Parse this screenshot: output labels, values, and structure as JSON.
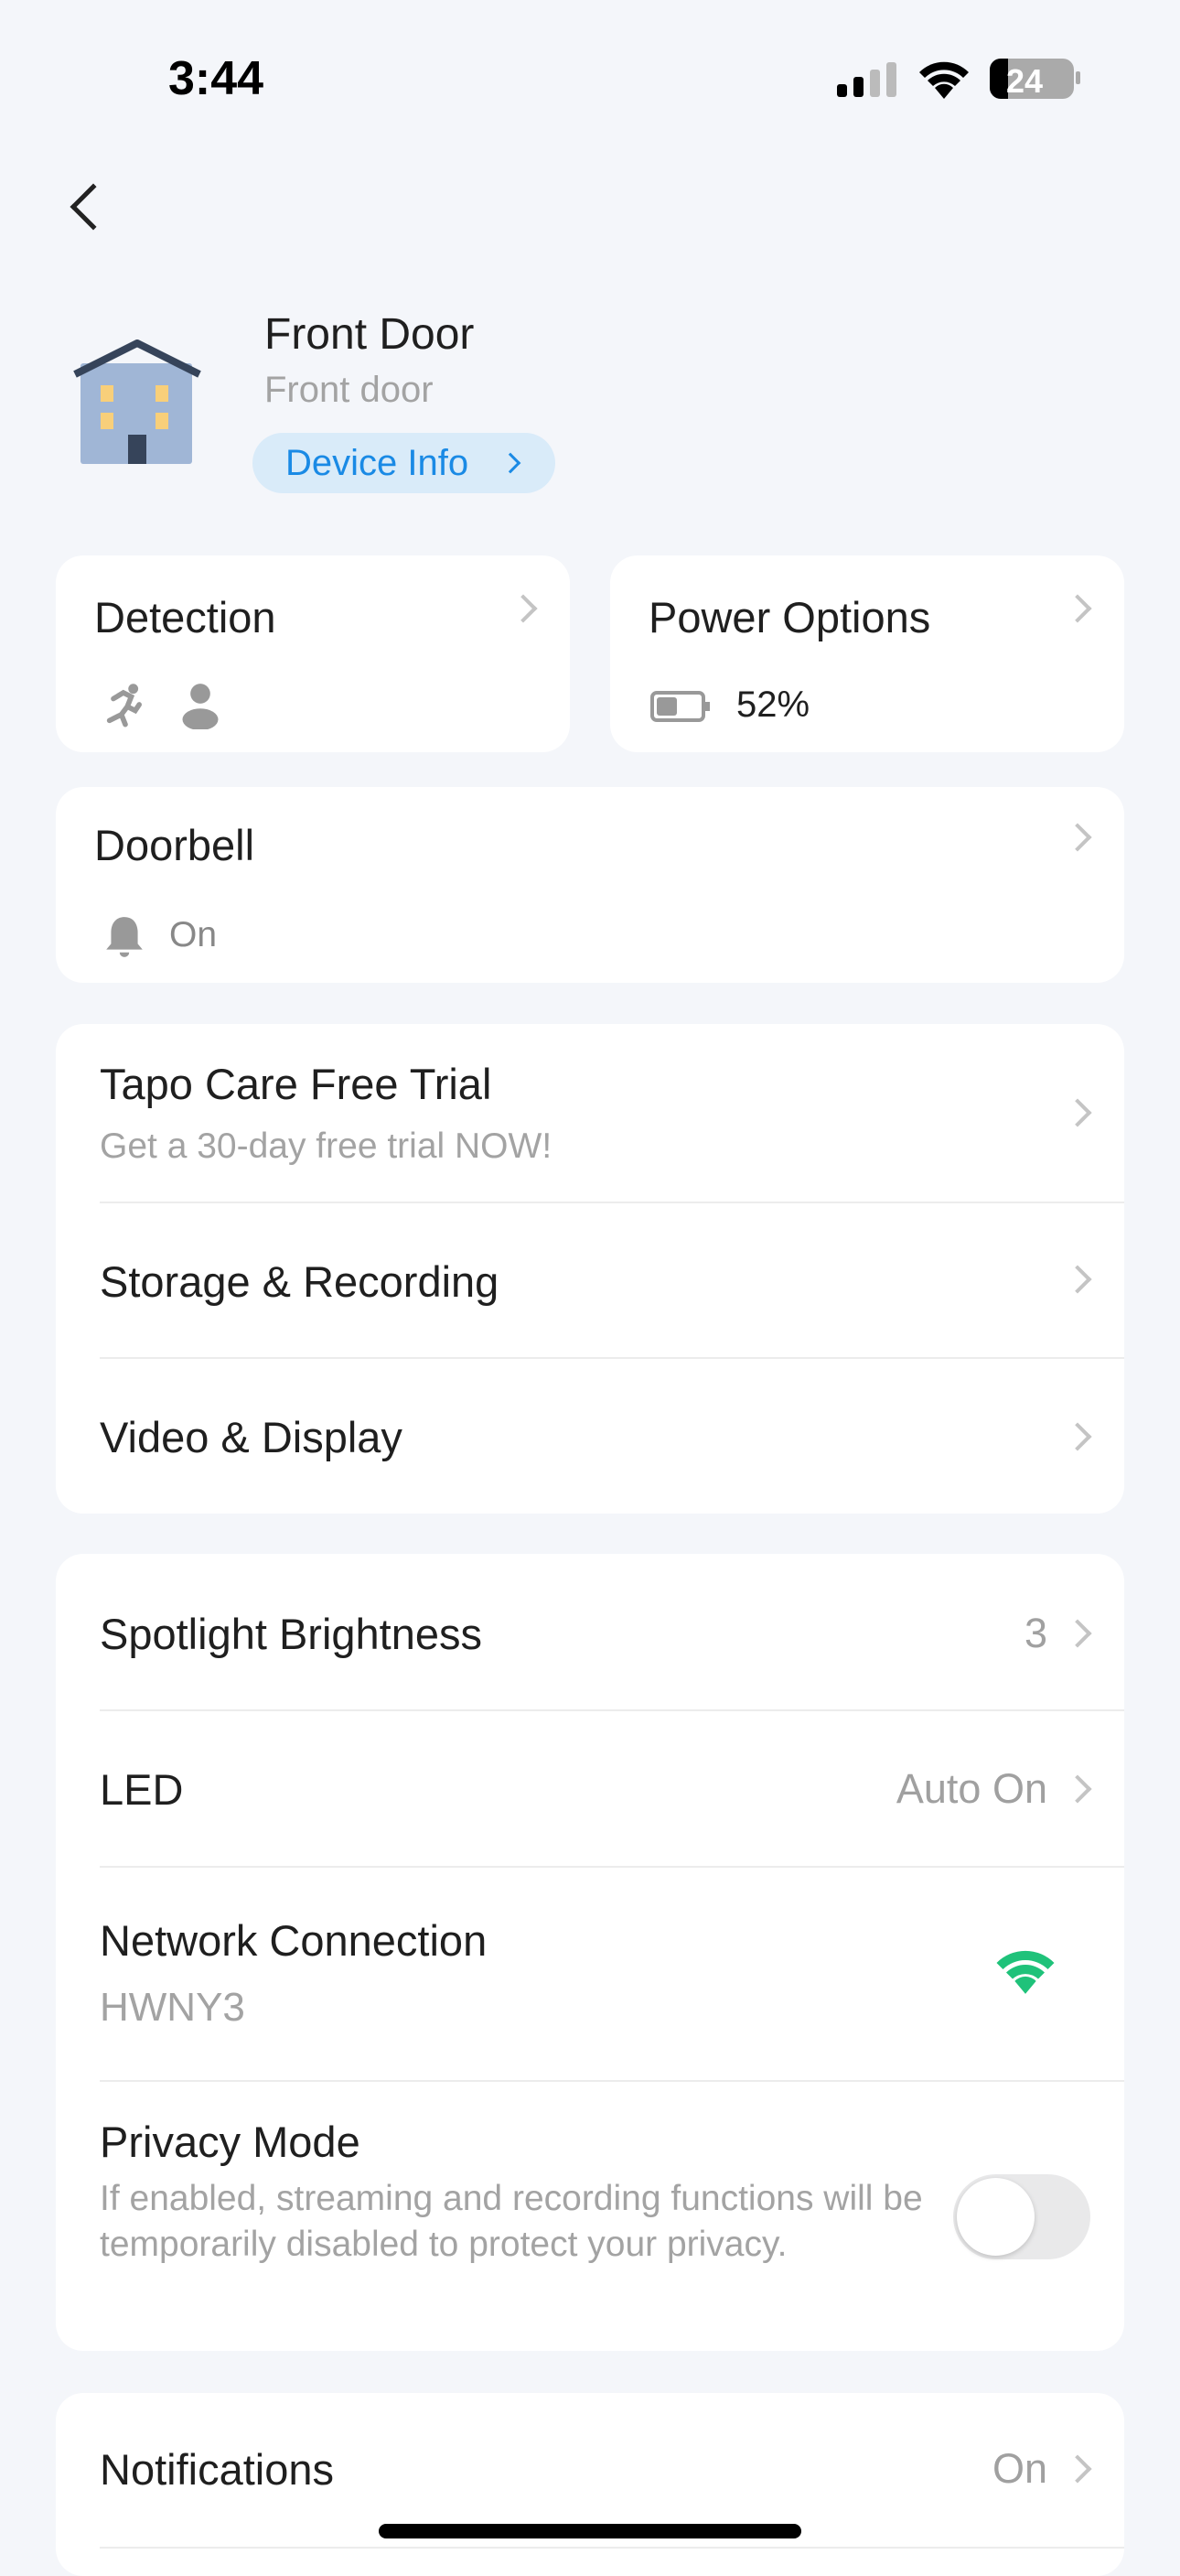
{
  "status_bar": {
    "time": "3:44",
    "battery": "24"
  },
  "device": {
    "name": "Front Door",
    "location": "Front door",
    "info_button": "Device Info"
  },
  "detection": {
    "label": "Detection"
  },
  "power": {
    "label": "Power Options",
    "battery_percent": "52%"
  },
  "doorbell": {
    "label": "Doorbell",
    "status": "On"
  },
  "group1": {
    "tapo_care": {
      "label": "Tapo Care Free Trial",
      "subtitle": "Get a 30-day free trial NOW!"
    },
    "storage": {
      "label": "Storage & Recording"
    },
    "video": {
      "label": "Video & Display"
    }
  },
  "group2": {
    "spotlight": {
      "label": "Spotlight Brightness",
      "value": "3"
    },
    "led": {
      "label": "LED",
      "value": "Auto On"
    },
    "network": {
      "label": "Network Connection",
      "ssid": "HWNY3",
      "signal_color": "#1fc27a"
    },
    "privacy": {
      "label": "Privacy Mode",
      "description": "If enabled, streaming and recording functions will be temporarily disabled to protect your privacy.",
      "enabled": false
    }
  },
  "notifications": {
    "label": "Notifications",
    "value": "On"
  },
  "colors": {
    "accent": "#1a8ae5",
    "pill_bg": "#d9ebf9"
  }
}
